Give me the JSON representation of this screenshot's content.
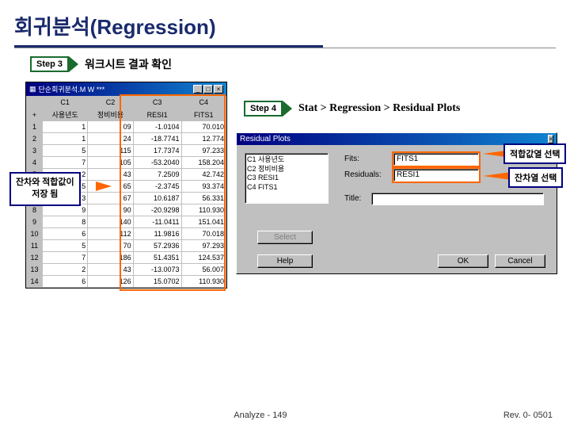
{
  "title": "회귀분석(Regression)",
  "step3": {
    "badge": "Step 3",
    "text": "워크시트 결과 확인"
  },
  "step4": {
    "badge": "Step 4",
    "text": "Stat > Regression > Residual Plots"
  },
  "worksheet": {
    "title": "단순회귀분석.M  W ***",
    "headers": [
      "",
      "C1",
      "C2",
      "C3",
      "C4"
    ],
    "subheaders": [
      "+",
      "사용년도",
      "정비비용",
      "RESI1",
      "FITS1"
    ],
    "rows": [
      [
        "1",
        "1",
        "09",
        "-1.0104",
        "70.010"
      ],
      [
        "2",
        "1",
        "24",
        "-18.7741",
        "12.774"
      ],
      [
        "3",
        "5",
        "115",
        "17.7374",
        "97.233"
      ],
      [
        "4",
        "7",
        "105",
        "-53.2040",
        "158.204"
      ],
      [
        "5",
        "2",
        "43",
        "7.2509",
        "42.742"
      ],
      [
        "6",
        "5",
        "65",
        "-2.3745",
        "93.374"
      ],
      [
        "7",
        "3",
        "67",
        "10.6187",
        "56.331"
      ],
      [
        "8",
        "9",
        "90",
        "-20.9298",
        "110.930"
      ],
      [
        "9",
        "8",
        "140",
        "-11.0411",
        "151.041"
      ],
      [
        "10",
        "6",
        "112",
        "11.9816",
        "70.018"
      ],
      [
        "11",
        "5",
        "70",
        "57.2936",
        "97.293"
      ],
      [
        "12",
        "7",
        "186",
        "51.4351",
        "124.537"
      ],
      [
        "13",
        "2",
        "43",
        "-13.0073",
        "56.007"
      ],
      [
        "14",
        "6",
        "126",
        "15.0702",
        "110.930"
      ]
    ]
  },
  "callouts": {
    "left_l1": "잔차와 적합값이",
    "left_l2": "저장 됨",
    "right1": "적합값열 선택",
    "right2": "잔차열 선택"
  },
  "dialog": {
    "title": "Residual Plots",
    "list": [
      "C1   사용년도",
      "C2   정비비용",
      "C3   RESI1",
      "C4   FITS1"
    ],
    "fits_label": "Fits:",
    "fits_value": "FITS1",
    "resid_label": "Residuals:",
    "resid_value": "RESI1",
    "title_label": "Title:",
    "title_value": "",
    "select": "Select",
    "help": "Help",
    "ok": "OK",
    "cancel": "Cancel"
  },
  "footer": {
    "left": "Analyze - 149",
    "right": "Rev. 0- 0501"
  }
}
